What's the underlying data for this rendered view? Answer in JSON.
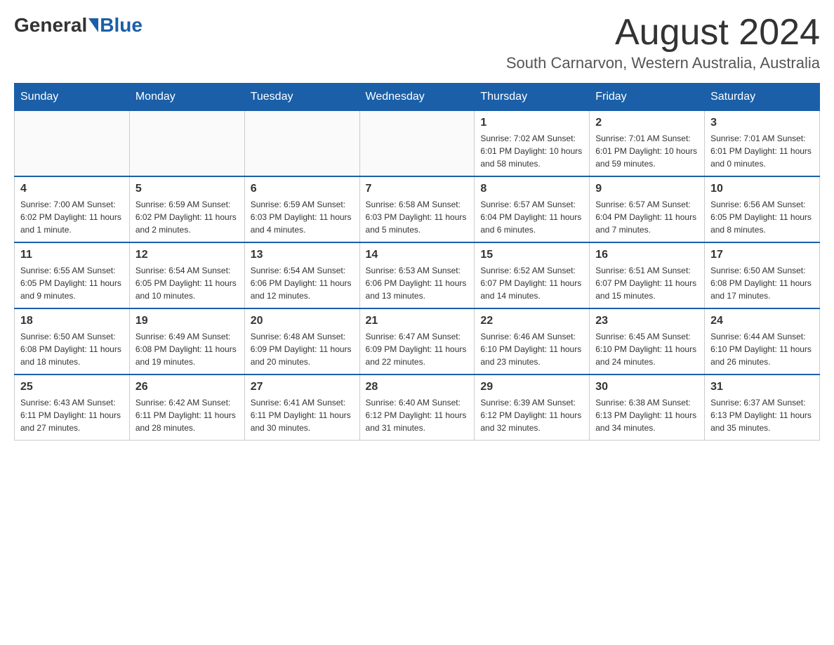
{
  "header": {
    "logo_general": "General",
    "logo_blue": "Blue",
    "month_title": "August 2024",
    "subtitle": "South Carnarvon, Western Australia, Australia"
  },
  "days_of_week": [
    "Sunday",
    "Monday",
    "Tuesday",
    "Wednesday",
    "Thursday",
    "Friday",
    "Saturday"
  ],
  "weeks": [
    [
      {
        "day": "",
        "info": ""
      },
      {
        "day": "",
        "info": ""
      },
      {
        "day": "",
        "info": ""
      },
      {
        "day": "",
        "info": ""
      },
      {
        "day": "1",
        "info": "Sunrise: 7:02 AM\nSunset: 6:01 PM\nDaylight: 10 hours and 58 minutes."
      },
      {
        "day": "2",
        "info": "Sunrise: 7:01 AM\nSunset: 6:01 PM\nDaylight: 10 hours and 59 minutes."
      },
      {
        "day": "3",
        "info": "Sunrise: 7:01 AM\nSunset: 6:01 PM\nDaylight: 11 hours and 0 minutes."
      }
    ],
    [
      {
        "day": "4",
        "info": "Sunrise: 7:00 AM\nSunset: 6:02 PM\nDaylight: 11 hours and 1 minute."
      },
      {
        "day": "5",
        "info": "Sunrise: 6:59 AM\nSunset: 6:02 PM\nDaylight: 11 hours and 2 minutes."
      },
      {
        "day": "6",
        "info": "Sunrise: 6:59 AM\nSunset: 6:03 PM\nDaylight: 11 hours and 4 minutes."
      },
      {
        "day": "7",
        "info": "Sunrise: 6:58 AM\nSunset: 6:03 PM\nDaylight: 11 hours and 5 minutes."
      },
      {
        "day": "8",
        "info": "Sunrise: 6:57 AM\nSunset: 6:04 PM\nDaylight: 11 hours and 6 minutes."
      },
      {
        "day": "9",
        "info": "Sunrise: 6:57 AM\nSunset: 6:04 PM\nDaylight: 11 hours and 7 minutes."
      },
      {
        "day": "10",
        "info": "Sunrise: 6:56 AM\nSunset: 6:05 PM\nDaylight: 11 hours and 8 minutes."
      }
    ],
    [
      {
        "day": "11",
        "info": "Sunrise: 6:55 AM\nSunset: 6:05 PM\nDaylight: 11 hours and 9 minutes."
      },
      {
        "day": "12",
        "info": "Sunrise: 6:54 AM\nSunset: 6:05 PM\nDaylight: 11 hours and 10 minutes."
      },
      {
        "day": "13",
        "info": "Sunrise: 6:54 AM\nSunset: 6:06 PM\nDaylight: 11 hours and 12 minutes."
      },
      {
        "day": "14",
        "info": "Sunrise: 6:53 AM\nSunset: 6:06 PM\nDaylight: 11 hours and 13 minutes."
      },
      {
        "day": "15",
        "info": "Sunrise: 6:52 AM\nSunset: 6:07 PM\nDaylight: 11 hours and 14 minutes."
      },
      {
        "day": "16",
        "info": "Sunrise: 6:51 AM\nSunset: 6:07 PM\nDaylight: 11 hours and 15 minutes."
      },
      {
        "day": "17",
        "info": "Sunrise: 6:50 AM\nSunset: 6:08 PM\nDaylight: 11 hours and 17 minutes."
      }
    ],
    [
      {
        "day": "18",
        "info": "Sunrise: 6:50 AM\nSunset: 6:08 PM\nDaylight: 11 hours and 18 minutes."
      },
      {
        "day": "19",
        "info": "Sunrise: 6:49 AM\nSunset: 6:08 PM\nDaylight: 11 hours and 19 minutes."
      },
      {
        "day": "20",
        "info": "Sunrise: 6:48 AM\nSunset: 6:09 PM\nDaylight: 11 hours and 20 minutes."
      },
      {
        "day": "21",
        "info": "Sunrise: 6:47 AM\nSunset: 6:09 PM\nDaylight: 11 hours and 22 minutes."
      },
      {
        "day": "22",
        "info": "Sunrise: 6:46 AM\nSunset: 6:10 PM\nDaylight: 11 hours and 23 minutes."
      },
      {
        "day": "23",
        "info": "Sunrise: 6:45 AM\nSunset: 6:10 PM\nDaylight: 11 hours and 24 minutes."
      },
      {
        "day": "24",
        "info": "Sunrise: 6:44 AM\nSunset: 6:10 PM\nDaylight: 11 hours and 26 minutes."
      }
    ],
    [
      {
        "day": "25",
        "info": "Sunrise: 6:43 AM\nSunset: 6:11 PM\nDaylight: 11 hours and 27 minutes."
      },
      {
        "day": "26",
        "info": "Sunrise: 6:42 AM\nSunset: 6:11 PM\nDaylight: 11 hours and 28 minutes."
      },
      {
        "day": "27",
        "info": "Sunrise: 6:41 AM\nSunset: 6:11 PM\nDaylight: 11 hours and 30 minutes."
      },
      {
        "day": "28",
        "info": "Sunrise: 6:40 AM\nSunset: 6:12 PM\nDaylight: 11 hours and 31 minutes."
      },
      {
        "day": "29",
        "info": "Sunrise: 6:39 AM\nSunset: 6:12 PM\nDaylight: 11 hours and 32 minutes."
      },
      {
        "day": "30",
        "info": "Sunrise: 6:38 AM\nSunset: 6:13 PM\nDaylight: 11 hours and 34 minutes."
      },
      {
        "day": "31",
        "info": "Sunrise: 6:37 AM\nSunset: 6:13 PM\nDaylight: 11 hours and 35 minutes."
      }
    ]
  ]
}
